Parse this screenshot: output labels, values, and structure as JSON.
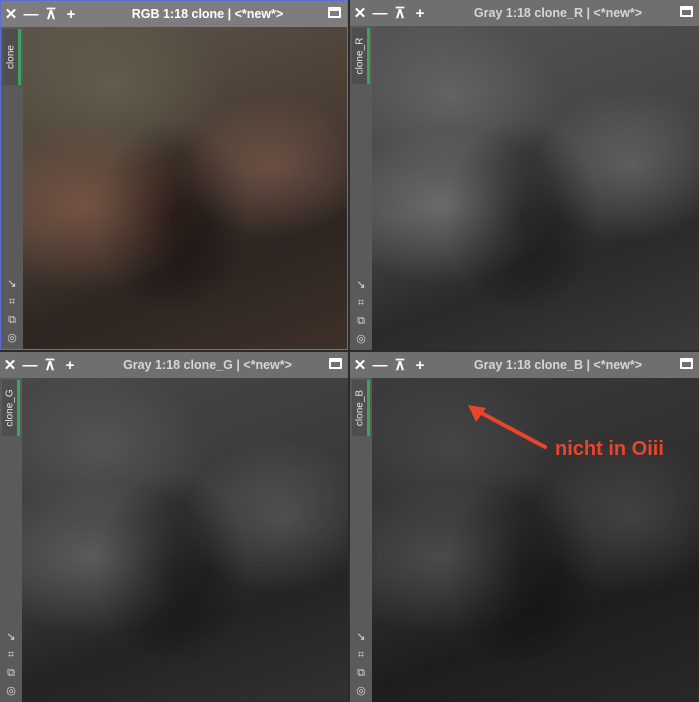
{
  "windows": [
    {
      "id": "rgb",
      "title": "RGB 1:18 clone | <*new*>",
      "tab": "clone",
      "active": true
    },
    {
      "id": "r",
      "title": "Gray 1:18 clone_R | <*new*>",
      "tab": "clone_R",
      "active": false
    },
    {
      "id": "g",
      "title": "Gray 1:18 clone_G | <*new*>",
      "tab": "clone_G",
      "active": false
    },
    {
      "id": "b",
      "title": "Gray 1:18 clone_B | <*new*>",
      "tab": "clone_B",
      "active": false
    }
  ],
  "titlebar_buttons": {
    "close": "✕",
    "minimize": "—",
    "shade": "⊼",
    "add": "+"
  },
  "side_icons": [
    "↘",
    "⌗",
    "⧉",
    "◎"
  ],
  "annotation": {
    "text": "nicht in Oiii",
    "color": "#e8452c"
  },
  "colors": {
    "active_border": "#5a6fd6",
    "tab_accent": "#3fa45a"
  }
}
